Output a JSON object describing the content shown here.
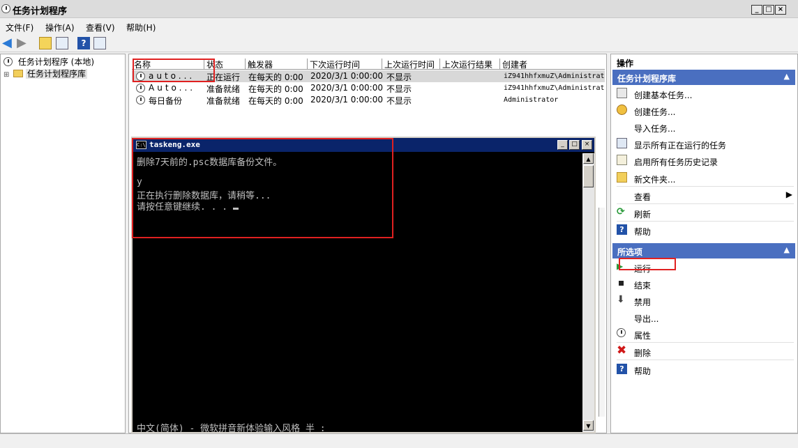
{
  "window": {
    "title": "任务计划程序",
    "controls": [
      "_",
      "□",
      "×"
    ]
  },
  "menubar": [
    "文件(F)",
    "操作(A)",
    "查看(V)",
    "帮助(H)"
  ],
  "tree": {
    "root": "任务计划程序 (本地)",
    "child": "任务计划程序库",
    "expander": "⊞"
  },
  "task_table": {
    "columns": [
      "名称",
      "状态",
      "触发器",
      "下次运行时间",
      "上次运行时间",
      "上次运行结果",
      "创建者"
    ],
    "rows": [
      {
        "name": "auto...",
        "status": "正在运行",
        "trigger": "在每天的 0:00",
        "next_run": "2020/3/1 0:00:00",
        "last_run": "不显示",
        "creator": "iZ941hhfxmuZ\\Administrat",
        "selected": true
      },
      {
        "name": "Auto...",
        "status": "准备就绪",
        "trigger": "在每天的 0:00",
        "next_run": "2020/3/1 0:00:00",
        "last_run": "不显示",
        "creator": "iZ941hhfxmuZ\\Administrat",
        "selected": false
      },
      {
        "name": "每日备份",
        "status": "准备就绪",
        "trigger": "在每天的 0:00",
        "next_run": "2020/3/1 0:00:00",
        "last_run": "不显示",
        "creator": "Administrator",
        "selected": false
      }
    ]
  },
  "console": {
    "title": "taskeng.exe",
    "icon_text": "C:\\",
    "lines": [
      "删除7天前的.psc数据库备份文件。",
      "",
      "y",
      "正在执行删除数据库，请稍等...",
      "请按任意键继续. . . "
    ],
    "ime_status": "中文(简体) - 微软拼音新体验输入风格 半 :"
  },
  "actions": {
    "header": "操作",
    "section1": {
      "title": "任务计划程序库",
      "items": [
        "创建基本任务...",
        "创建任务...",
        "导入任务...",
        "显示所有正在运行的任务",
        "启用所有任务历史记录",
        "新文件夹...",
        "查看",
        "刷新",
        "帮助"
      ]
    },
    "section2": {
      "title": "所选项",
      "items": [
        "运行",
        "结束",
        "禁用",
        "导出...",
        "属性",
        "删除",
        "帮助"
      ]
    }
  },
  "colors": {
    "section_header": "#4a6fc0",
    "console_title": "#0a246a",
    "annotation": "#e02020"
  }
}
